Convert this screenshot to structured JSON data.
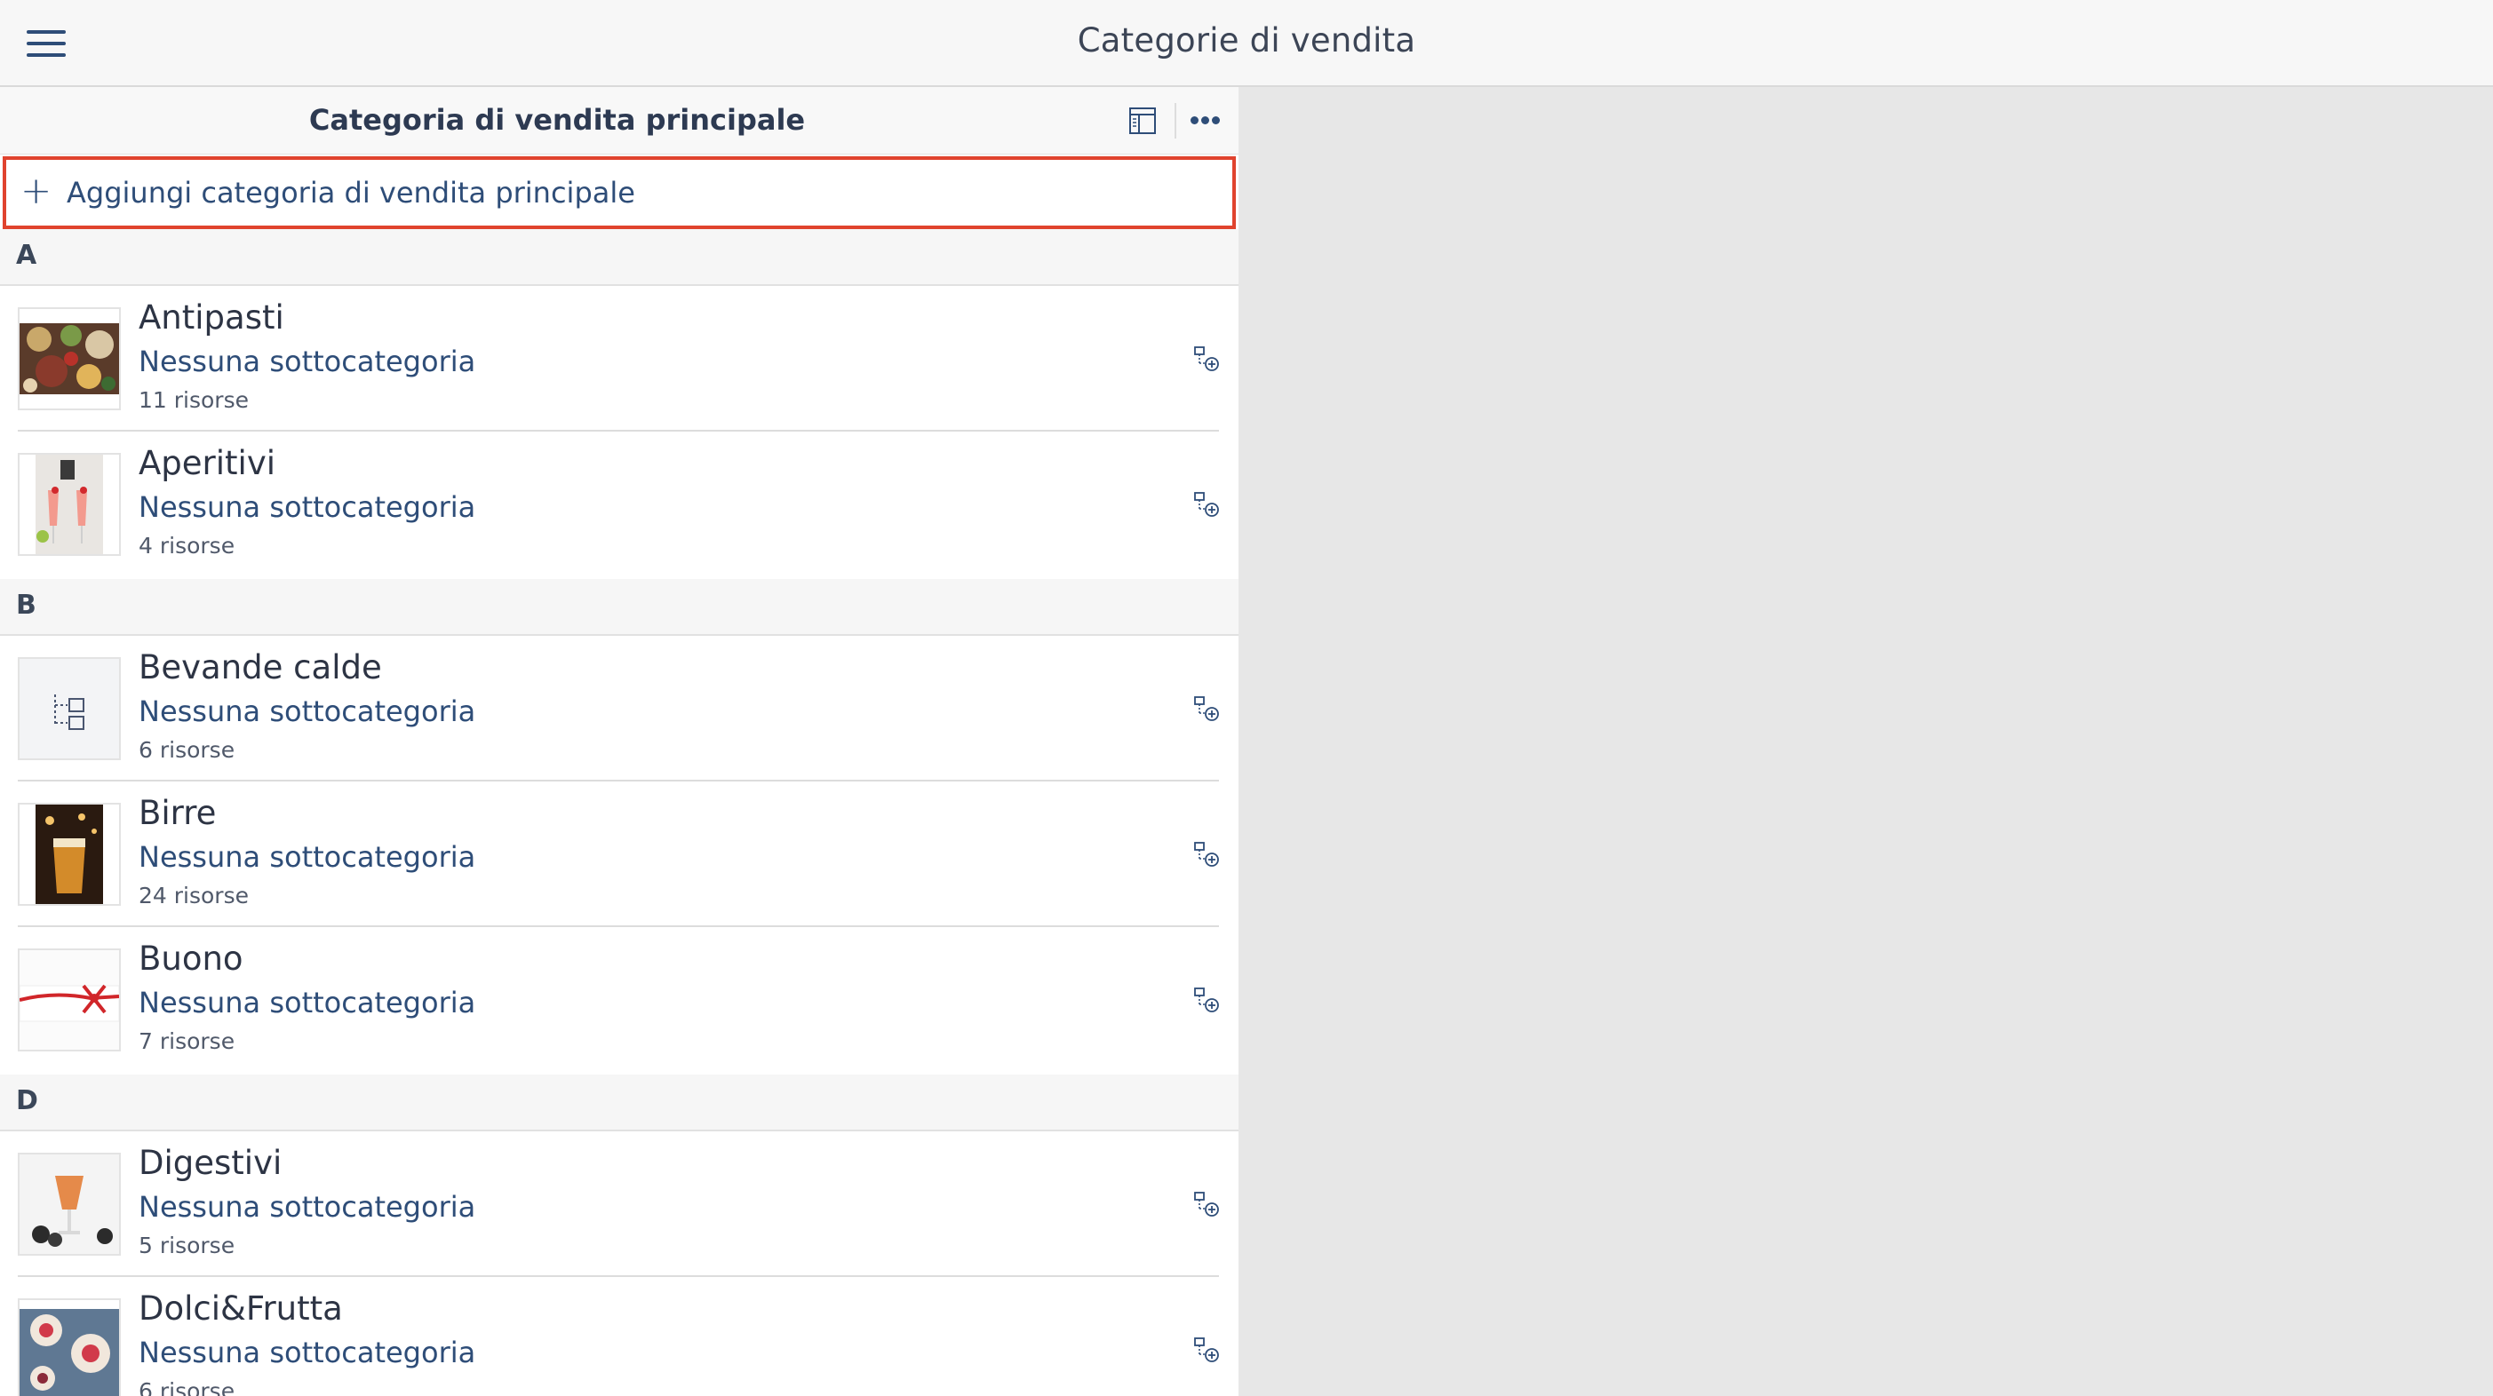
{
  "app": {
    "title": "Categorie di vendita",
    "menu_icon": "hamburger-menu-icon"
  },
  "panel": {
    "title": "Categoria di vendita principale",
    "layout_icon": "layout-panels-icon",
    "more_icon": "more-dots-icon",
    "add": {
      "icon": "plus",
      "label": "Aggiungi categoria di vendita principale"
    }
  },
  "sections": [
    {
      "letter": "A",
      "items": [
        {
          "name": "Antipasti",
          "subtitle": "Nessuna sottocategoria",
          "count": "11 risorse",
          "thumb": "food-platter-photo"
        },
        {
          "name": "Aperitivi",
          "subtitle": "Nessuna sottocategoria",
          "count": "4 risorse",
          "thumb": "aperitif-glasses-photo"
        }
      ]
    },
    {
      "letter": "B",
      "items": [
        {
          "name": "Bevande calde",
          "subtitle": "Nessuna sottocategoria",
          "count": "6 risorse",
          "thumb": "category-tree-placeholder-icon"
        },
        {
          "name": "Birre",
          "subtitle": "Nessuna sottocategoria",
          "count": "24 risorse",
          "thumb": "beer-glass-photo"
        },
        {
          "name": "Buono",
          "subtitle": "Nessuna sottocategoria",
          "count": "7 risorse",
          "thumb": "gift-ribbon-photo"
        }
      ]
    },
    {
      "letter": "D",
      "items": [
        {
          "name": "Digestivi",
          "subtitle": "Nessuna sottocategoria",
          "count": "5 risorse",
          "thumb": "digestif-glass-photo"
        },
        {
          "name": "Dolci&Frutta",
          "subtitle": "Nessuna sottocategoria",
          "count": "6 risorse",
          "thumb": "desserts-fruit-photo"
        }
      ]
    }
  ],
  "row_action_icon": "add-subcategory-icon",
  "colors": {
    "accent": "#2e4d78",
    "highlight_border": "#e0432e",
    "background": "#e7e7e7",
    "header_bg": "#f7f7f7"
  }
}
